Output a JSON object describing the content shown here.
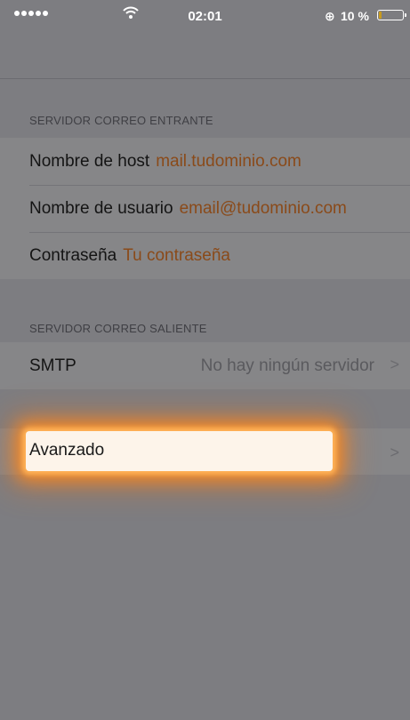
{
  "status_bar": {
    "time": "02:01",
    "battery": "10 %"
  },
  "incoming": {
    "header": "SERVIDOR CORREO ENTRANTE",
    "rows": [
      {
        "label": "Nombre de host",
        "value": "mail.tudominio.com"
      },
      {
        "label": "Nombre de usuario",
        "value": "email@tudominio.com"
      },
      {
        "label": "Contraseña",
        "value": "Tu contraseña"
      }
    ]
  },
  "outgoing": {
    "header": "SERVIDOR CORREO SALIENTE",
    "smtp_label": "SMTP",
    "smtp_value": "No hay ningún servidor"
  },
  "advanced": {
    "label": "Avanzado"
  },
  "colors": {
    "accent": "#8a4a19",
    "highlight_glow": "#ff8c1e"
  },
  "icons": [
    "signal-icon",
    "wifi-icon",
    "lock-rotation-icon",
    "battery-icon",
    "chevron-right-icon"
  ]
}
